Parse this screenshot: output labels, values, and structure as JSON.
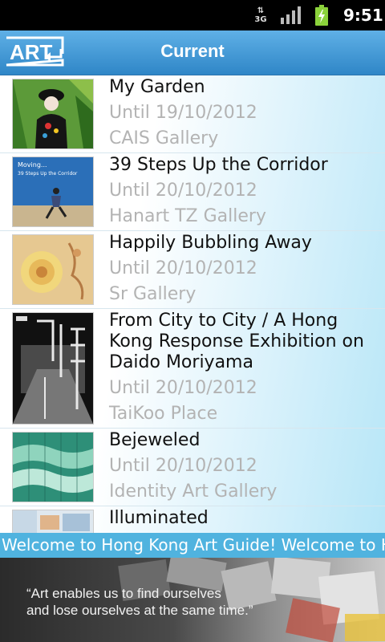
{
  "status_bar": {
    "network": "3G",
    "time": "9:51",
    "icons": [
      "3g-icon",
      "signal-icon",
      "battery-charging-icon"
    ]
  },
  "header": {
    "logo_text": "ART",
    "title": "Current"
  },
  "exhibitions": [
    {
      "title": "My Garden",
      "until": "Until 19/10/2012",
      "venue": "CAIS Gallery"
    },
    {
      "title": "39 Steps Up the Corridor",
      "thumb_text": [
        "Moving...",
        "39 Steps Up the Corridor"
      ],
      "until": "Until 20/10/2012",
      "venue": "Hanart TZ Gallery"
    },
    {
      "title": "Happily Bubbling Away",
      "until": "Until 20/10/2012",
      "venue": "Sr Gallery"
    },
    {
      "title": "From City to City / A Hong Kong Response Exhibition on Daido Moriyama",
      "until": "Until 20/10/2012",
      "venue": "TaiKoo Place"
    },
    {
      "title": "Bejeweled",
      "until": "Until 20/10/2012",
      "venue": "Identity Art Gallery"
    },
    {
      "title": "Illuminated"
    }
  ],
  "ticker": {
    "text": "Welcome to Hong Kong Art Guide!  Welcome to Hong Kong Art Guide!"
  },
  "banner": {
    "quote_line1": "“Art enables us to find ourselves",
    "quote_line2": "and lose ourselves at the same time.”"
  },
  "colors": {
    "title_bar": "#3b95d6",
    "ticker": "#50b3df",
    "muted_text": "#b3b3b3"
  }
}
